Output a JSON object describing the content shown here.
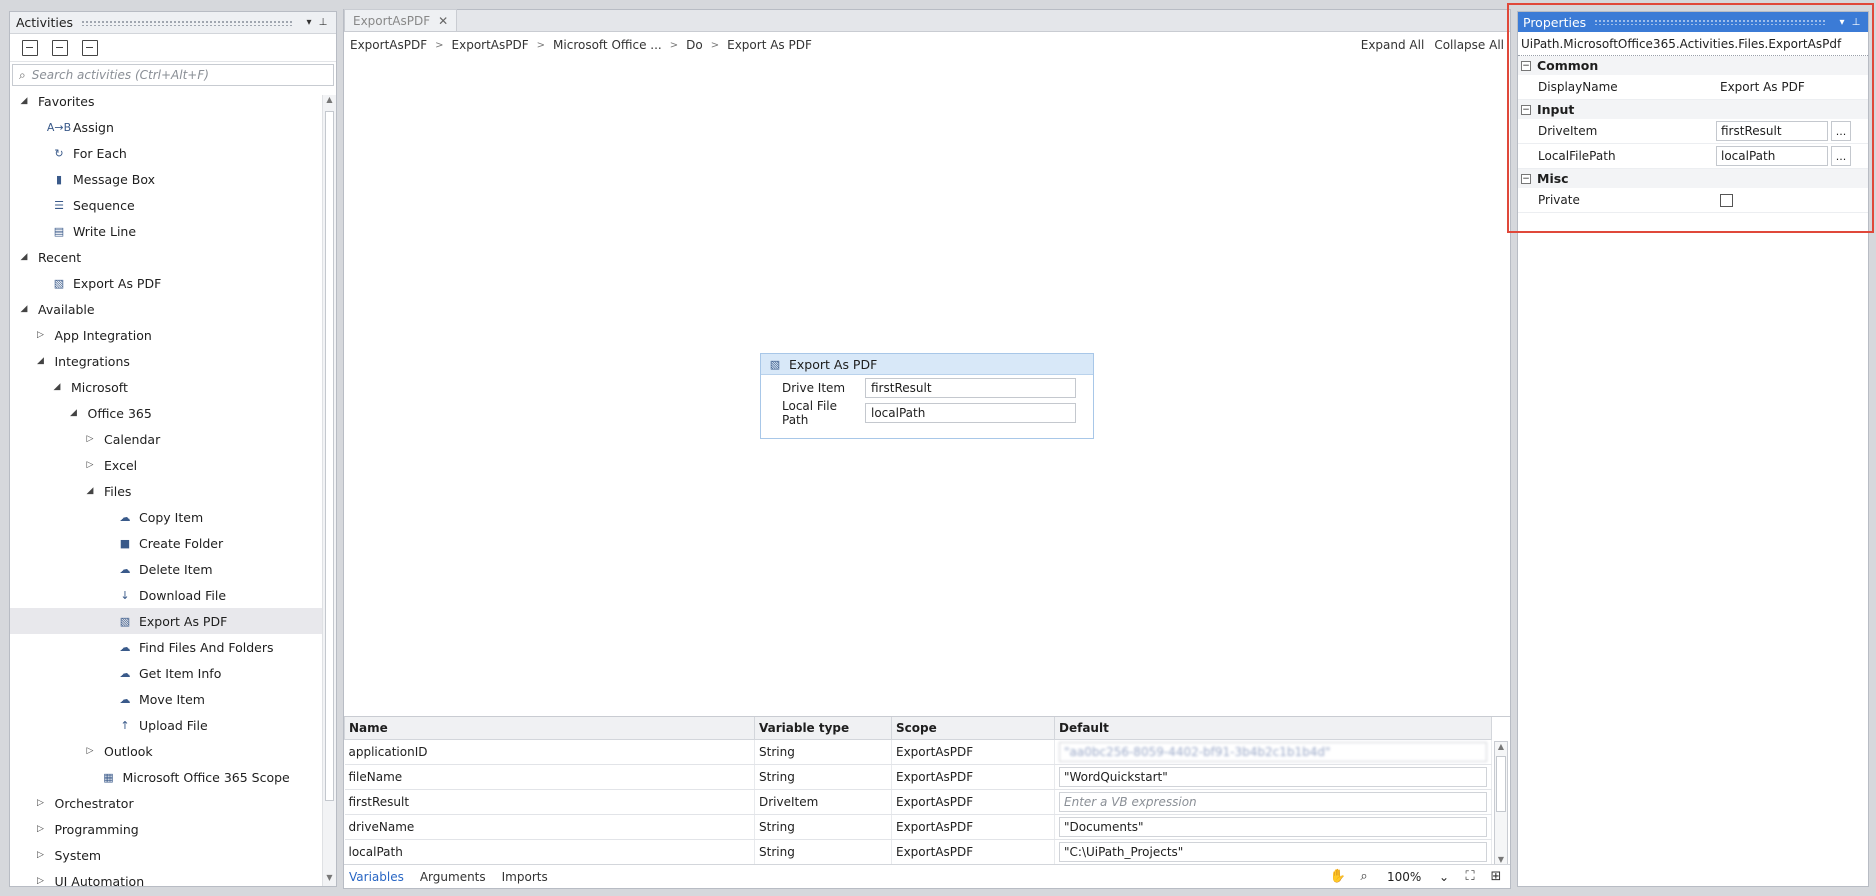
{
  "activities": {
    "title": "Activities",
    "search_placeholder": "Search activities (Ctrl+Alt+F)",
    "tree": [
      {
        "label": "Favorites",
        "level": 0,
        "type": "group",
        "expanded": true
      },
      {
        "label": "Assign",
        "level": 2,
        "type": "leaf",
        "icon": "A→B"
      },
      {
        "label": "For Each",
        "level": 2,
        "type": "leaf",
        "icon": "↻"
      },
      {
        "label": "Message Box",
        "level": 2,
        "type": "leaf",
        "icon": "▮"
      },
      {
        "label": "Sequence",
        "level": 2,
        "type": "leaf",
        "icon": "☰"
      },
      {
        "label": "Write Line",
        "level": 2,
        "type": "leaf",
        "icon": "▤"
      },
      {
        "label": "Recent",
        "level": 0,
        "type": "group",
        "expanded": true
      },
      {
        "label": "Export As PDF",
        "level": 2,
        "type": "leaf",
        "icon": "▧"
      },
      {
        "label": "Available",
        "level": 0,
        "type": "group",
        "expanded": true
      },
      {
        "label": "App Integration",
        "level": 1,
        "type": "group",
        "expanded": false
      },
      {
        "label": "Integrations",
        "level": 1,
        "type": "group",
        "expanded": true
      },
      {
        "label": "Microsoft",
        "level": 2,
        "type": "group",
        "expanded": true
      },
      {
        "label": "Office 365",
        "level": 3,
        "type": "group",
        "expanded": true
      },
      {
        "label": "Calendar",
        "level": 4,
        "type": "group",
        "expanded": false
      },
      {
        "label": "Excel",
        "level": 4,
        "type": "group",
        "expanded": false
      },
      {
        "label": "Files",
        "level": 4,
        "type": "group",
        "expanded": true
      },
      {
        "label": "Copy Item",
        "level": 6,
        "type": "leaf",
        "icon": "☁"
      },
      {
        "label": "Create Folder",
        "level": 6,
        "type": "leaf",
        "icon": "■"
      },
      {
        "label": "Delete Item",
        "level": 6,
        "type": "leaf",
        "icon": "☁"
      },
      {
        "label": "Download File",
        "level": 6,
        "type": "leaf",
        "icon": "↓"
      },
      {
        "label": "Export As PDF",
        "level": 6,
        "type": "leaf",
        "icon": "▧",
        "selected": true
      },
      {
        "label": "Find Files And Folders",
        "level": 6,
        "type": "leaf",
        "icon": "☁"
      },
      {
        "label": "Get Item Info",
        "level": 6,
        "type": "leaf",
        "icon": "☁"
      },
      {
        "label": "Move Item",
        "level": 6,
        "type": "leaf",
        "icon": "☁"
      },
      {
        "label": "Upload File",
        "level": 6,
        "type": "leaf",
        "icon": "↑"
      },
      {
        "label": "Outlook",
        "level": 4,
        "type": "group",
        "expanded": false
      },
      {
        "label": "Microsoft Office 365 Scope",
        "level": 5,
        "type": "leaf",
        "icon": "▦"
      },
      {
        "label": "Orchestrator",
        "level": 1,
        "type": "group",
        "expanded": false
      },
      {
        "label": "Programming",
        "level": 1,
        "type": "group",
        "expanded": false
      },
      {
        "label": "System",
        "level": 1,
        "type": "group",
        "expanded": false
      },
      {
        "label": "UI Automation",
        "level": 1,
        "type": "group",
        "expanded": false
      }
    ]
  },
  "designer": {
    "tab_label": "ExportAsPDF",
    "breadcrumb": [
      "ExportAsPDF",
      "ExportAsPDF",
      "Microsoft Office ...",
      "Do",
      "Export As PDF"
    ],
    "expand_all": "Expand All",
    "collapse_all": "Collapse All",
    "activity": {
      "title": "Export As PDF",
      "fields": [
        {
          "label": "Drive Item",
          "value": "firstResult"
        },
        {
          "label": "Local File Path",
          "value": "localPath"
        }
      ]
    },
    "variables": {
      "columns": [
        "Name",
        "Variable type",
        "Scope",
        "Default"
      ],
      "rows": [
        {
          "name": "applicationID",
          "type": "String",
          "scope": "ExportAsPDF",
          "default": "\"aa0bc256-8059-4402-bf91-3b4b2c1b1b4d\"",
          "blurred": true
        },
        {
          "name": "fileName",
          "type": "String",
          "scope": "ExportAsPDF",
          "default": "\"WordQuickstart\""
        },
        {
          "name": "firstResult",
          "type": "DriveItem",
          "scope": "ExportAsPDF",
          "default": "Enter a VB expression",
          "placeholder": true
        },
        {
          "name": "driveName",
          "type": "String",
          "scope": "ExportAsPDF",
          "default": "\"Documents\""
        },
        {
          "name": "localPath",
          "type": "String",
          "scope": "ExportAsPDF",
          "default": "\"C:\\UiPath_Projects\""
        }
      ]
    },
    "bottom_tabs": [
      "Variables",
      "Arguments",
      "Imports"
    ],
    "zoom": "100%"
  },
  "properties": {
    "title": "Properties",
    "type_name": "UiPath.MicrosoftOffice365.Activities.Files.ExportAsPdf",
    "categories": [
      {
        "name": "Common",
        "rows": [
          {
            "name": "DisplayName",
            "value": "Export As PDF",
            "kind": "text"
          }
        ]
      },
      {
        "name": "Input",
        "rows": [
          {
            "name": "DriveItem",
            "value": "firstResult",
            "kind": "input"
          },
          {
            "name": "LocalFilePath",
            "value": "localPath",
            "kind": "input"
          }
        ]
      },
      {
        "name": "Misc",
        "rows": [
          {
            "name": "Private",
            "value": "",
            "kind": "checkbox"
          }
        ]
      }
    ]
  },
  "colors": {
    "accent": "#3b7bd6",
    "highlight": "#e0483a",
    "selection": "#e8e8ec"
  }
}
